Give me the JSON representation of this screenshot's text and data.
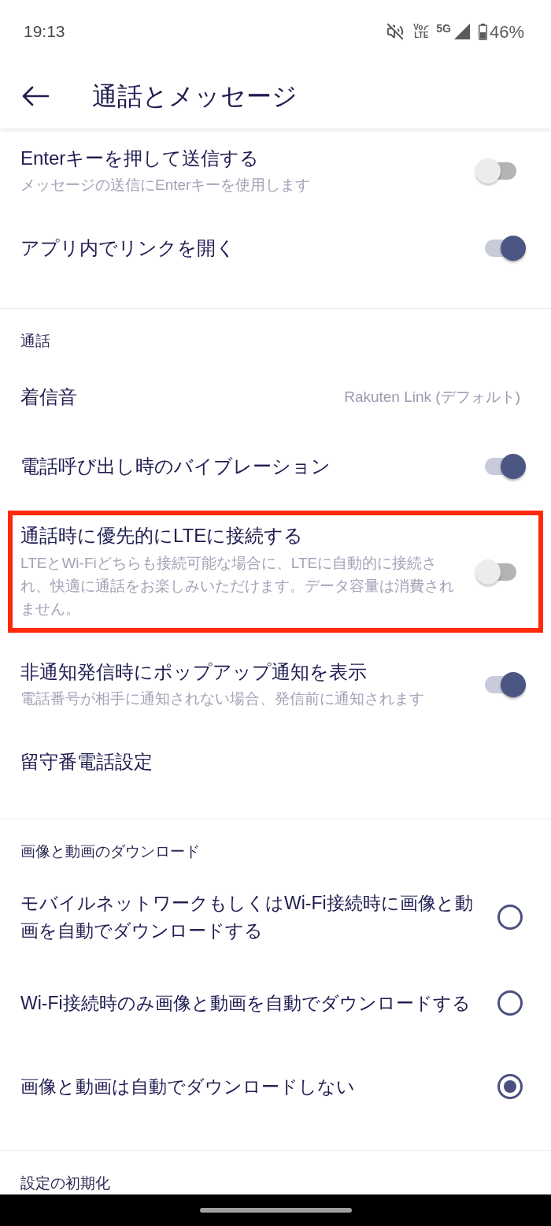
{
  "status_bar": {
    "time": "19:13",
    "volte_top": "Vo",
    "volte_bottom": "LTE",
    "network": "5G",
    "battery": "46%"
  },
  "app_bar": {
    "title": "通話とメッセージ"
  },
  "sections": [
    {
      "items": [
        {
          "kind": "toggle",
          "title": "Enterキーを押して送信する",
          "subtitle": "メッセージの送信にEnterキーを使用します",
          "on": false
        },
        {
          "kind": "toggle",
          "title": "アプリ内でリンクを開く",
          "on": true
        }
      ]
    },
    {
      "header": "通話",
      "items": [
        {
          "kind": "value",
          "title": "着信音",
          "value": "Rakuten Link (デフォルト)",
          "highlighted": false
        },
        {
          "kind": "toggle",
          "title": "電話呼び出し時のバイブレーション",
          "on": true,
          "highlighted": false
        },
        {
          "kind": "toggle",
          "title": "通話時に優先的にLTEに接続する",
          "subtitle": "LTEとWi-Fiどちらも接続可能な場合に、LTEに自動的に接続され、快適に通話をお楽しみいただけます。データ容量は消費されません。",
          "on": false,
          "highlighted": true
        },
        {
          "kind": "toggle",
          "title": "非通知発信時にポップアップ通知を表示",
          "subtitle": "電話番号が相手に通知されない場合、発信前に通知されます",
          "on": true,
          "highlighted": false
        },
        {
          "kind": "link",
          "title": "留守番電話設定",
          "highlighted": false
        }
      ]
    },
    {
      "header": "画像と動画のダウンロード",
      "items": [
        {
          "kind": "radio",
          "title": "モバイルネットワークもしくはWi-Fi接続時に画像と動画を自動でダウンロードする",
          "selected": false
        },
        {
          "kind": "radio",
          "title": "Wi-Fi接続時のみ画像と動画を自動でダウンロードする",
          "selected": false
        },
        {
          "kind": "radio",
          "title": "画像と動画は自動でダウンロードしない",
          "selected": true
        }
      ]
    },
    {
      "header": "設定の初期化"
    }
  ]
}
